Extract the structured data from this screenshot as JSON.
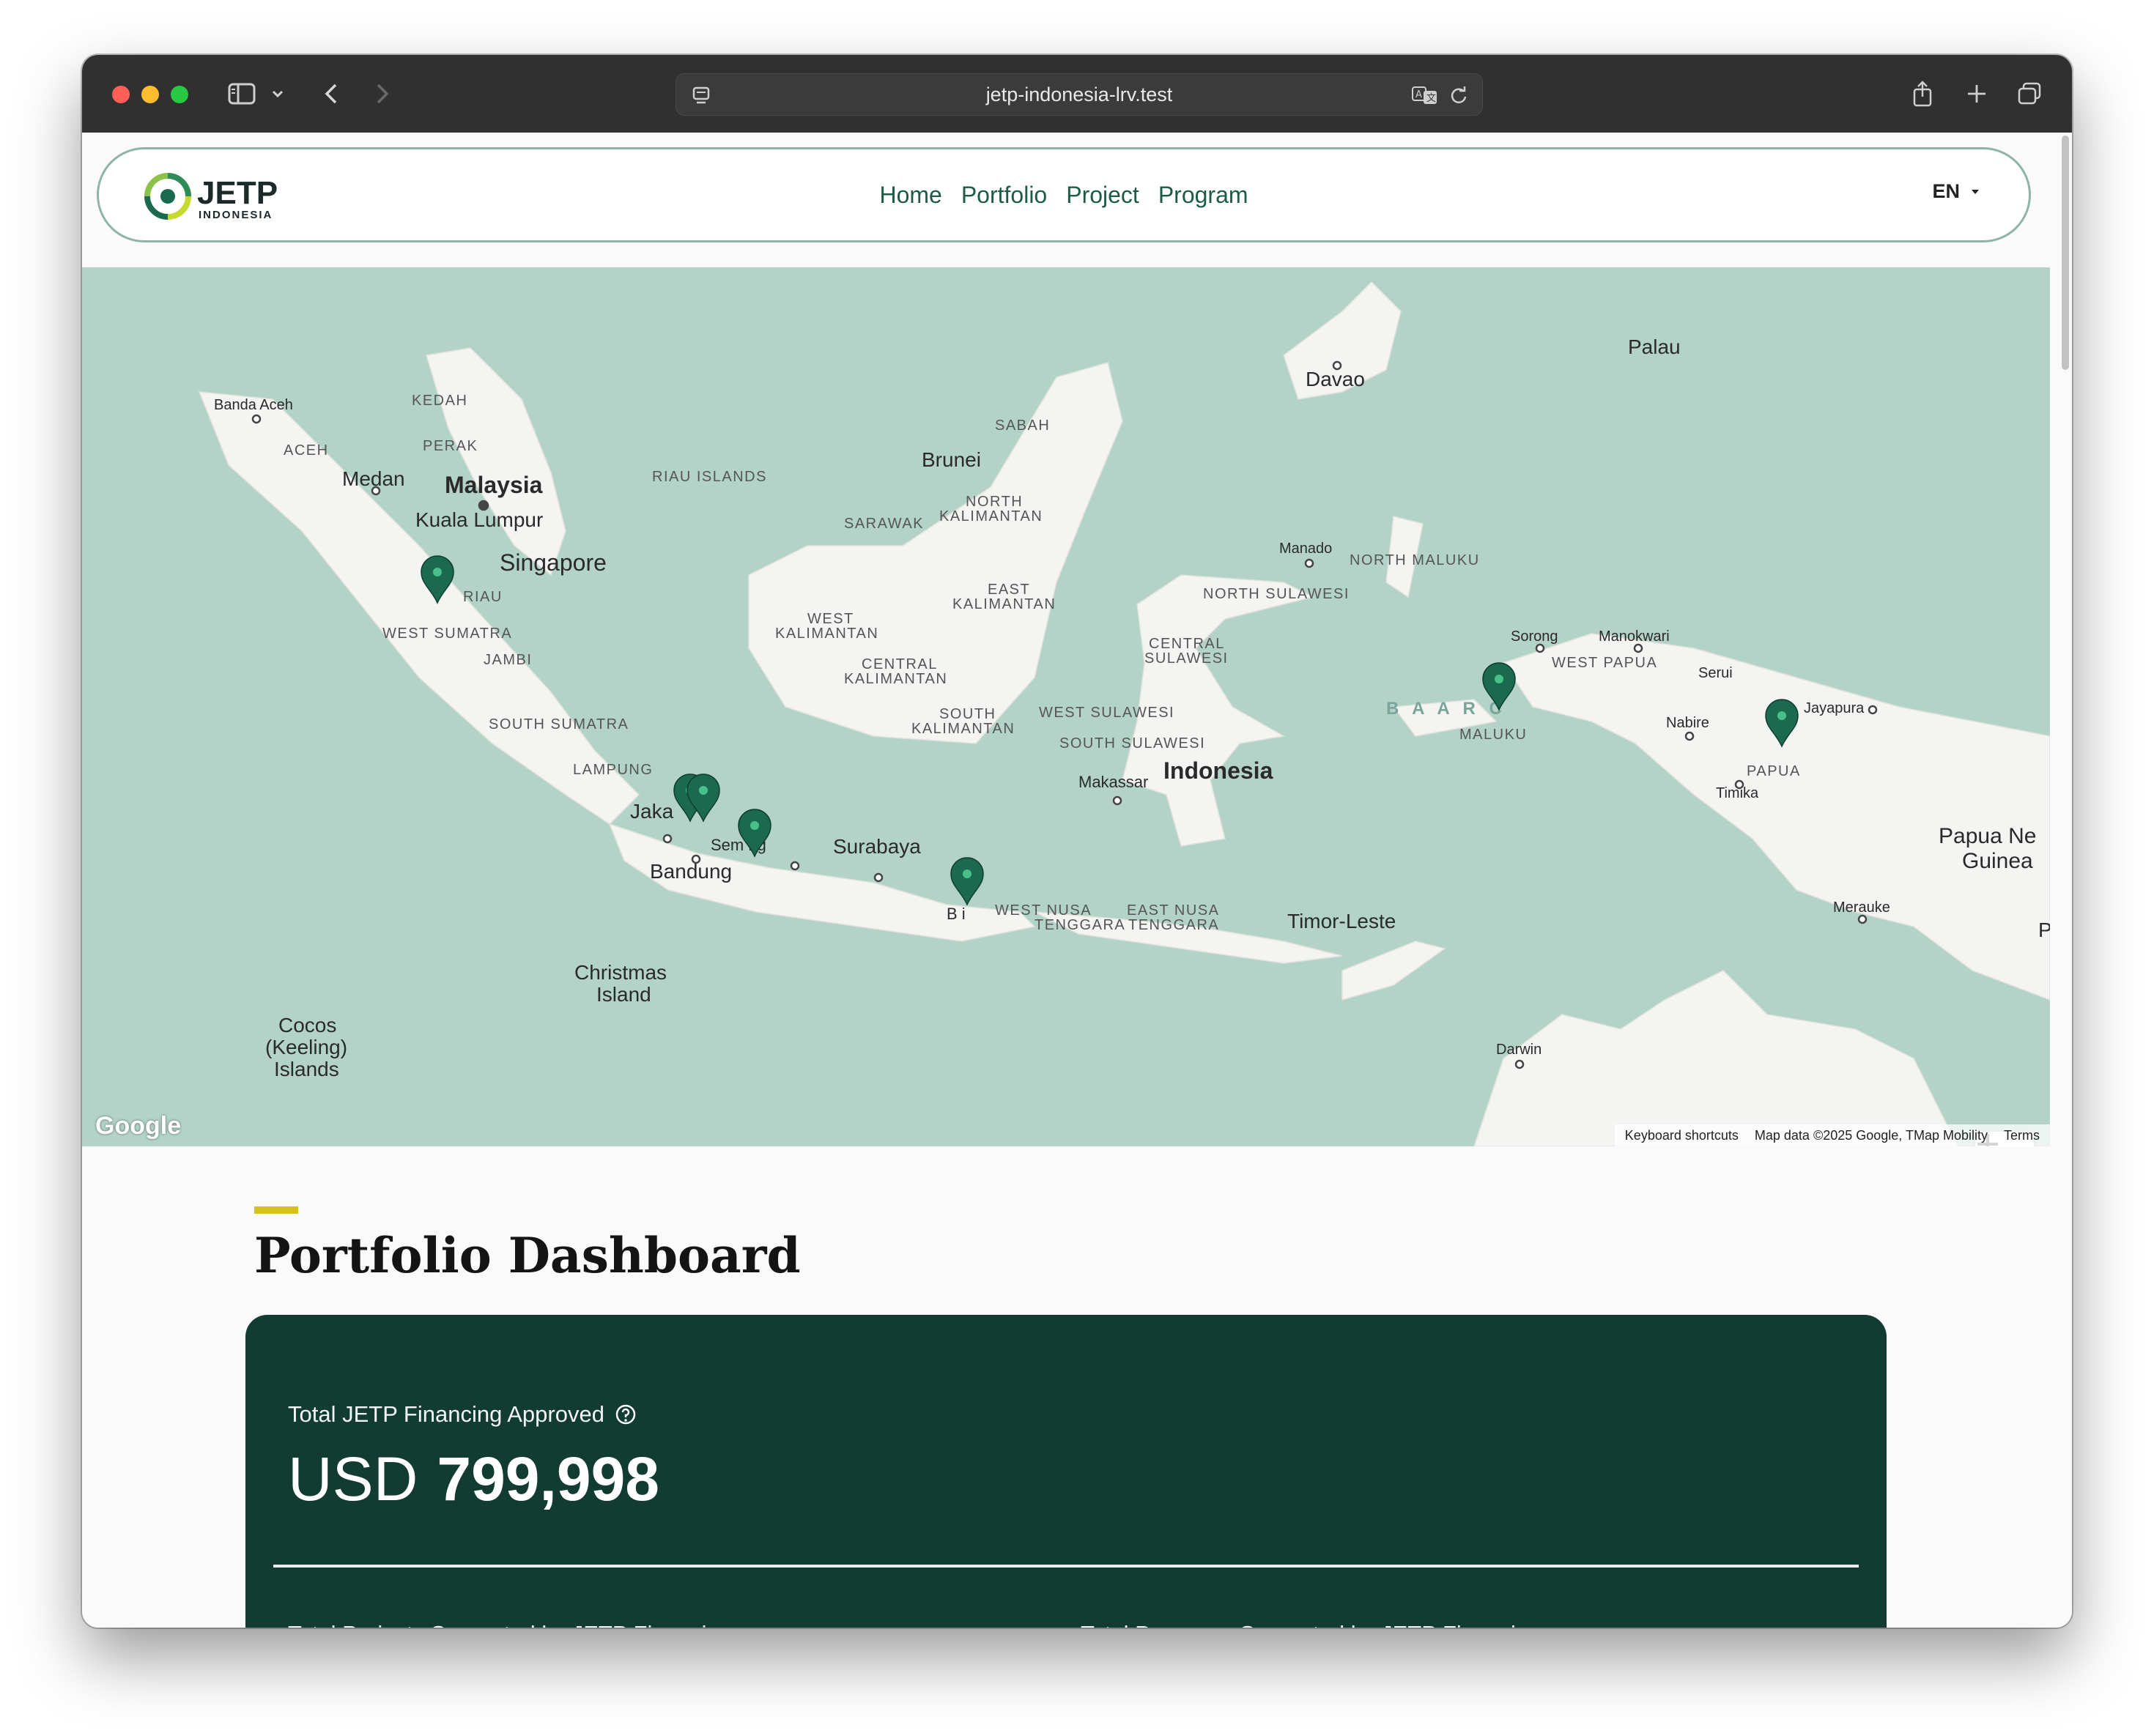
{
  "browser": {
    "url": "jetp-indonesia-lrv.test"
  },
  "navbar": {
    "logo_text": "JETP",
    "logo_subtext": "INDONESIA",
    "links": [
      "Home",
      "Portfolio",
      "Project",
      "Program"
    ],
    "language": "EN"
  },
  "map": {
    "labels": {
      "banda_aceh": "Banda Aceh",
      "kedah": "KEDAH",
      "aceh": "ACEH",
      "perak": "PERAK",
      "medan": "Medan",
      "malaysia": "Malaysia",
      "kuala_lumpur": "Kuala Lumpur",
      "riau_islands": "RIAU ISLANDS",
      "singapore": "Singapore",
      "riau": "RIAU",
      "west_sumatra": "WEST SUMATRA",
      "jambi": "JAMBI",
      "south_sumatra": "SOUTH SUMATRA",
      "lampung": "LAMPUNG",
      "jakarta": "Jaka",
      "semarang": "Sem    ng",
      "bandung": "Bandung",
      "surabaya": "Surabaya",
      "bali": "B  i",
      "west_nusa_tenggara_1": "WEST NUSA",
      "west_nusa_tenggara_2": "TENGGARA",
      "east_nusa_tenggara_1": "EAST NUSA",
      "east_nusa_tenggara_2": "TENGGARA",
      "timor_leste": "Timor-Leste",
      "christmas_island_1": "Christmas",
      "christmas_island_2": "Island",
      "cocos_1": "Cocos",
      "cocos_2": "(Keeling)",
      "cocos_3": "Islands",
      "sabah": "SABAH",
      "brunei": "Brunei",
      "sarawak": "SARAWAK",
      "north_kalimantan_1": "NORTH",
      "north_kalimantan_2": "KALIMANTAN",
      "east_kalimantan_1": "EAST",
      "east_kalimantan_2": "KALIMANTAN",
      "west_kalimantan_1": "WEST",
      "west_kalimantan_2": "KALIMANTAN",
      "central_kalimantan_1": "CENTRAL",
      "central_kalimantan_2": "KALIMANTAN",
      "south_kalimantan_1": "SOUTH",
      "south_kalimantan_2": "KALIMANTAN",
      "davao": "Davao",
      "palau": "Palau",
      "manado": "Manado",
      "north_maluku": "NORTH MALUKU",
      "north_sulawesi": "NORTH SULAWESI",
      "central_sulawesi_1": "CENTRAL",
      "central_sulawesi_2": "SULAWESI",
      "west_sulawesi": "WEST SULAWESI",
      "south_sulawesi": "SOUTH SULAWESI",
      "makassar": "Makassar",
      "indonesia": "Indonesia",
      "sorong": "Sorong",
      "manokwari": "Manokwari",
      "west_papua": "WEST PAPUA",
      "serui": "Serui",
      "jayapura": "Jayapura",
      "nabire": "Nabire",
      "maluku": "MALUKU",
      "papua": "PAPUA",
      "timika": "Timika",
      "papua_new_guinea_1": "Papua Ne",
      "papua_new_guinea_2": "Guinea",
      "merauke": "Merauke",
      "darwin": "Darwin",
      "banda_sea": "B A  A R C",
      "edge_p": "P"
    },
    "markers": [
      "riau-marker",
      "jakarta-marker-1",
      "jakarta-marker-2",
      "semarang-marker",
      "bali-marker",
      "maluku-marker",
      "papua-marker"
    ],
    "google_logo": "Google",
    "footer": {
      "shortcuts": "Keyboard shortcuts",
      "data": "Map data ©2025 Google, TMap Mobility",
      "terms": "Terms"
    }
  },
  "dashboard": {
    "title": "Portfolio Dashboard",
    "financing_label": "Total JETP Financing Approved",
    "currency": "USD",
    "financing_value": "799,998",
    "projects_label": "Total Projects Supported by JETP Financing",
    "programs_label": "Total Programs Supported by JETP Financing"
  },
  "colors": {
    "brand_green": "#1d5b47",
    "card_bg": "#123b32",
    "accent": "#d8c11b",
    "map_water": "#b3d3c9",
    "map_land": "#f4f4f2",
    "marker": "#1b6a4f"
  }
}
